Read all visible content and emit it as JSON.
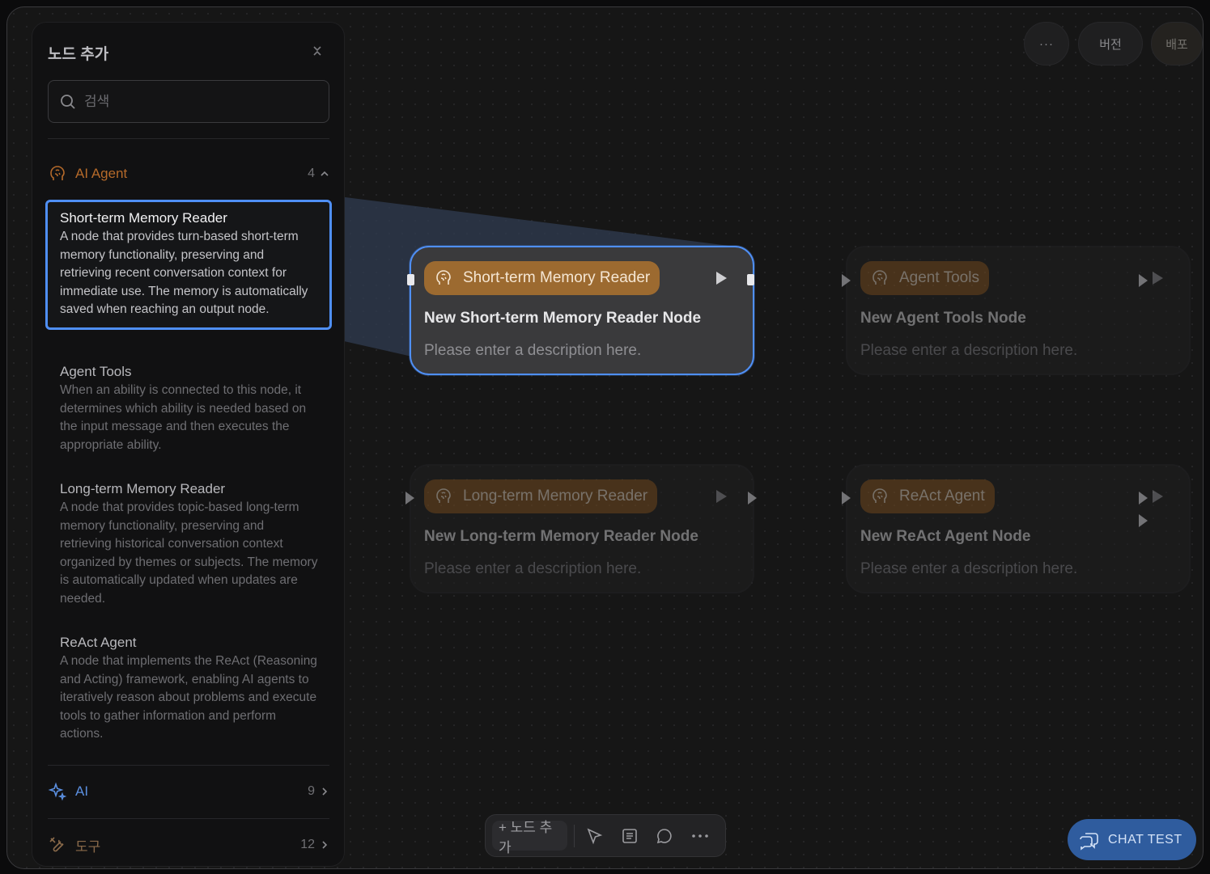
{
  "header": {
    "more_label": "···",
    "version_label": "버전",
    "deploy_label": "배포"
  },
  "panel": {
    "title": "노드 추가",
    "search_placeholder": "검색",
    "categories": [
      {
        "name": "AI Agent",
        "count": "4",
        "color": "#b56a2a",
        "icon": "brain-icon",
        "expanded": true
      },
      {
        "name": "AI",
        "count": "9",
        "color": "#5b8fe0",
        "icon": "sparkle-icon",
        "expanded": false
      },
      {
        "name": "도구",
        "count": "12",
        "color": "#b56a2a",
        "icon": "tools-icon",
        "expanded": false
      }
    ],
    "items": [
      {
        "name": "Short-term Memory Reader",
        "desc": "A node that provides turn-based short-term memory functionality, preserving and retrieving recent conversation context for immediate use. The memory is automatically saved when reaching an output node."
      },
      {
        "name": "Agent Tools",
        "desc": "When an ability is connected to this node, it determines which ability is needed based on the input message and then executes the appropriate ability."
      },
      {
        "name": "Long-term Memory Reader",
        "desc": "A node that provides topic-based long-term memory functionality, preserving and retrieving historical conversation context organized by themes or subjects. The memory is automatically updated when updates are needed."
      },
      {
        "name": "ReAct Agent",
        "desc": "A node that implements the ReAct (Reasoning and Acting) framework, enabling AI agents to iteratively reason about problems and execute tools to gather information and perform actions."
      }
    ]
  },
  "nodes": [
    {
      "type": "Short-term Memory Reader",
      "title": "New Short-term Memory Reader Node",
      "desc": "Please enter a description here."
    },
    {
      "type": "Agent Tools",
      "title": "New Agent Tools Node",
      "desc": "Please enter a description here."
    },
    {
      "type": "Long-term Memory Reader",
      "title": "New Long-term Memory Reader Node",
      "desc": "Please enter a description here."
    },
    {
      "type": "ReAct Agent",
      "title": "New ReAct Agent Node",
      "desc": "Please enter a description here."
    }
  ],
  "toolbar": {
    "add_label": "+ 노드 추가"
  },
  "chat_test": {
    "label": "CHAT TEST"
  },
  "colors": {
    "accent": "#4f8ff5",
    "node_pill": "#8a5a26",
    "chat_button": "#2f5c9e"
  }
}
